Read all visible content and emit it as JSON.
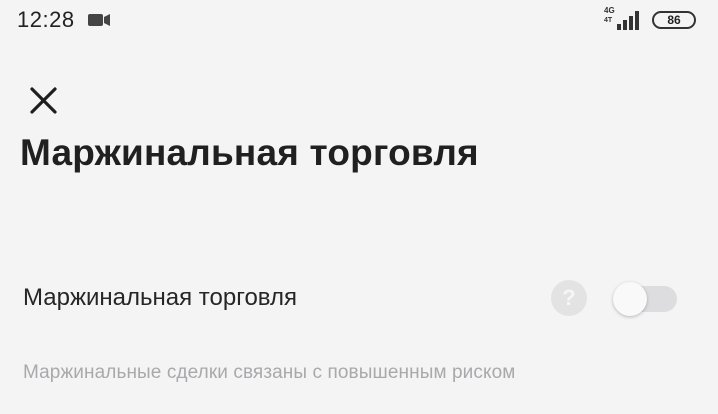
{
  "statusbar": {
    "time": "12:28",
    "network_type": "4G",
    "network_sub": "4T",
    "battery_level": "86",
    "icons": [
      "video-camera-icon",
      "signal-icon",
      "battery-icon"
    ]
  },
  "header": {
    "close_icon": "close-icon",
    "title": "Маржинальная торговля"
  },
  "setting": {
    "label": "Маржинальная торговля",
    "help_icon_glyph": "?",
    "toggle_state": "off"
  },
  "note": {
    "text": "Маржинальные сделки связаны с повышенным риском"
  },
  "colors": {
    "background": "#f4f4f5",
    "toggle_track": "#dddddf",
    "note_text": "#a9a9ab"
  }
}
